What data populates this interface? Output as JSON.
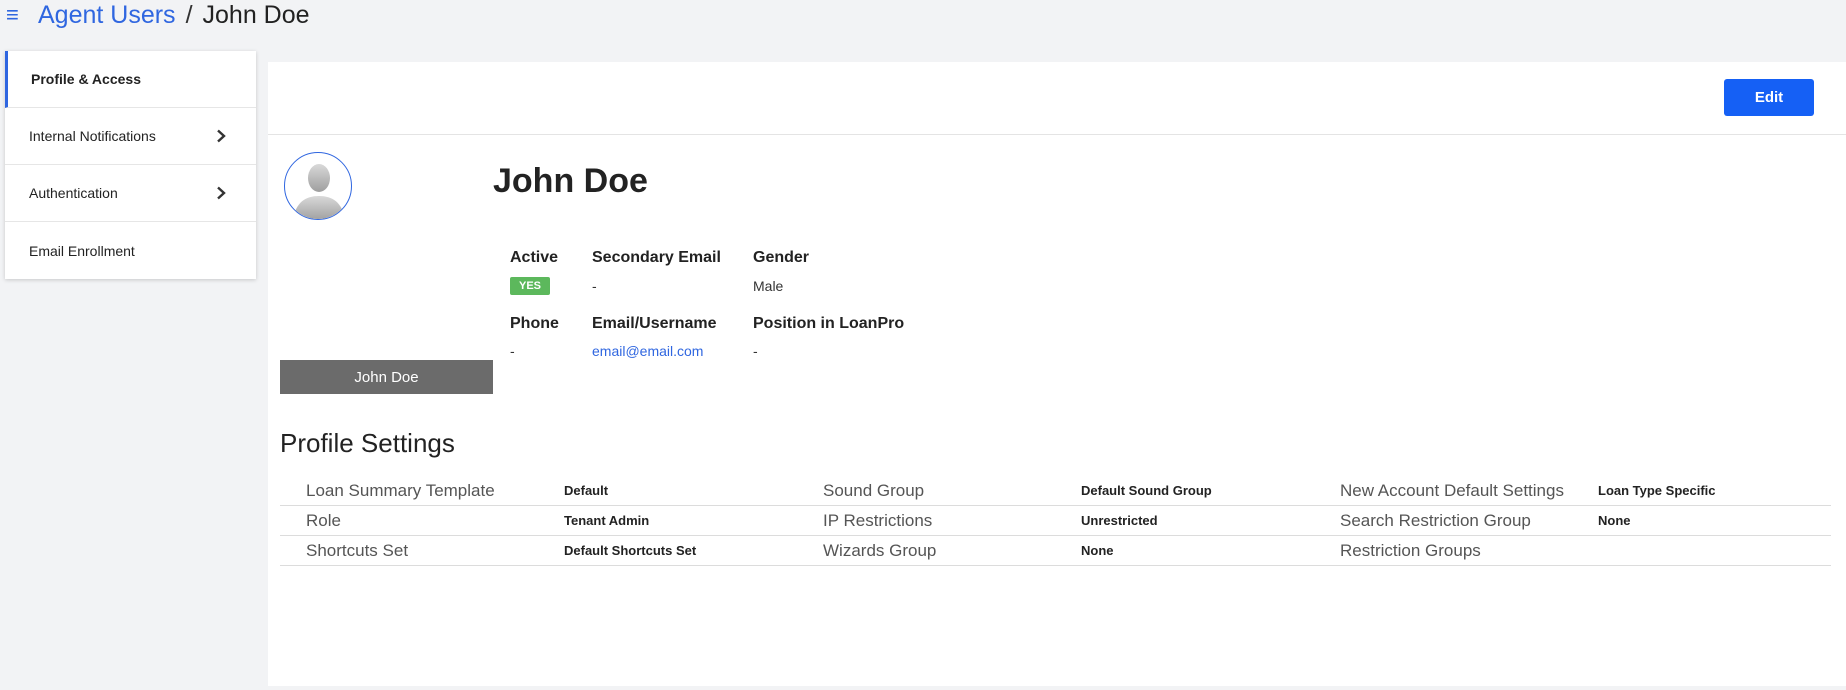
{
  "breadcrumb": {
    "menu_icon": "hamburger-menu-icon",
    "parent": "Agent Users",
    "separator": "/",
    "current": "John Doe"
  },
  "sidebar": {
    "items": [
      {
        "label": "Profile & Access",
        "active": true,
        "chevron": false
      },
      {
        "label": "Internal Notifications",
        "active": false,
        "chevron": true
      },
      {
        "label": "Authentication",
        "active": false,
        "chevron": true
      },
      {
        "label": "Email Enrollment",
        "active": false,
        "chevron": false
      }
    ]
  },
  "toolbar": {
    "edit_label": "Edit"
  },
  "profile": {
    "name": "John Doe",
    "avatar_caption": "John Doe",
    "fields": {
      "active": {
        "label": "Active",
        "value": "YES"
      },
      "secondary_email": {
        "label": "Secondary Email",
        "value": "-"
      },
      "gender": {
        "label": "Gender",
        "value": "Male"
      },
      "phone": {
        "label": "Phone",
        "value": "-"
      },
      "email_username": {
        "label": "Email/Username",
        "value": "email@email.com"
      },
      "position": {
        "label": "Position in LoanPro",
        "value": "-"
      }
    }
  },
  "profile_settings": {
    "title": "Profile Settings",
    "columns": [
      [
        {
          "label": "Loan Summary Template",
          "value": "Default"
        },
        {
          "label": "Role",
          "value": "Tenant Admin"
        },
        {
          "label": "Shortcuts Set",
          "value": "Default Shortcuts Set"
        }
      ],
      [
        {
          "label": "Sound Group",
          "value": "Default Sound Group"
        },
        {
          "label": "IP Restrictions",
          "value": "Unrestricted"
        },
        {
          "label": "Wizards Group",
          "value": "None"
        }
      ],
      [
        {
          "label": "New Account Default Settings",
          "value": "Loan Type Specific"
        },
        {
          "label": "Search Restriction Group",
          "value": "None"
        },
        {
          "label": "Restriction Groups",
          "value": ""
        }
      ]
    ]
  },
  "colors": {
    "accent": "#2f66e0",
    "edit_button": "#1560f5",
    "active_badge": "#5cb85c",
    "name_bar": "#6b6b6b"
  }
}
